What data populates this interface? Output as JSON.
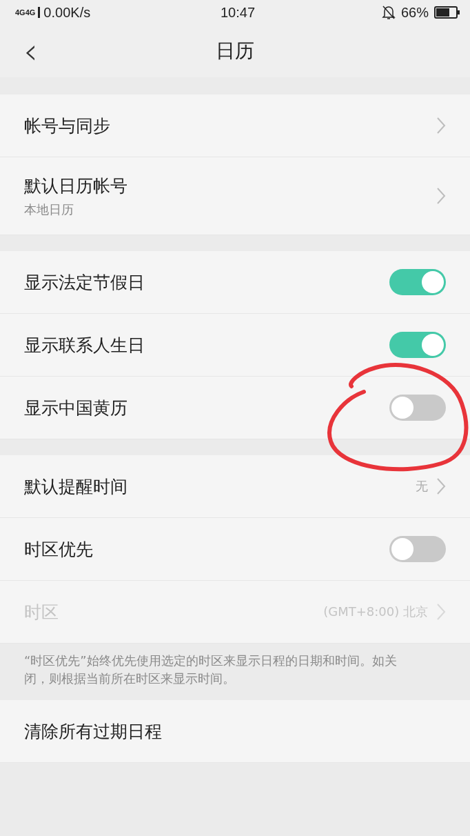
{
  "status_bar": {
    "network": "4G4G",
    "speed": "0.00K/s",
    "time": "10:47",
    "battery": "66%"
  },
  "header": {
    "back": "‹",
    "title": "日历"
  },
  "groups": [
    {
      "rows": [
        {
          "kind": "link",
          "label": "帐号与同步",
          "disabled": false
        },
        {
          "kind": "link",
          "label": "默认日历帐号",
          "subtitle": "本地日历",
          "disabled": false
        }
      ]
    },
    {
      "rows": [
        {
          "kind": "toggle",
          "label": "显示法定节假日",
          "on": true
        },
        {
          "kind": "toggle",
          "label": "显示联系人生日",
          "on": true
        },
        {
          "kind": "toggle",
          "label": "显示中国黄历",
          "on": false
        }
      ]
    },
    {
      "rows": [
        {
          "kind": "link",
          "label": "默认提醒时间",
          "value": "无",
          "disabled": false
        },
        {
          "kind": "toggle",
          "label": "时区优先",
          "on": false
        },
        {
          "kind": "link",
          "label": "时区",
          "value": "(GMT+8:00) 北京",
          "disabled": true
        }
      ],
      "note": "“时区优先”始终优先使用选定的时区来显示日程的日期和时间。如关闭，则根据当前所在时区来显示时间。"
    },
    {
      "rows": [
        {
          "kind": "action",
          "label": "清除所有过期日程"
        }
      ]
    }
  ]
}
